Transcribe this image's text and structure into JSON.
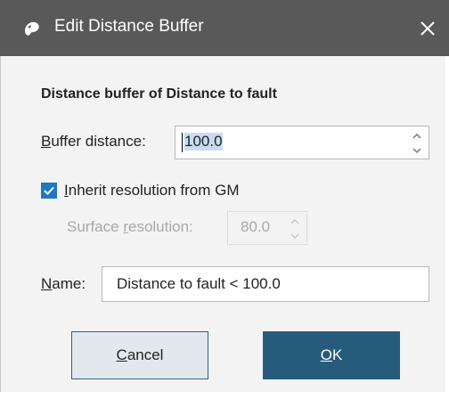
{
  "window": {
    "title": "Edit Distance Buffer",
    "icon": "app-logo-icon",
    "close_icon": "close-icon"
  },
  "heading": "Distance buffer of Distance to fault",
  "buffer_distance": {
    "label_key": "B",
    "label_rest": "uffer distance:",
    "value": "100.0"
  },
  "inherit": {
    "label_key": "I",
    "label_rest": "nherit resolution from GM",
    "checked": true
  },
  "surface_resolution": {
    "label_pre": "Surface ",
    "label_key": "r",
    "label_rest": "esolution:",
    "value": "80.0",
    "enabled": false
  },
  "name": {
    "label_key": "N",
    "label_rest": "ame:",
    "value": "Distance to fault < 100.0"
  },
  "buttons": {
    "cancel_key": "C",
    "cancel_rest": "ancel",
    "ok_key": "O",
    "ok_rest": "K"
  },
  "colors": {
    "title_bar": "#595959",
    "accent": "#1f78c1",
    "ok_button": "#265b7c",
    "body": "#f3f3f3"
  }
}
